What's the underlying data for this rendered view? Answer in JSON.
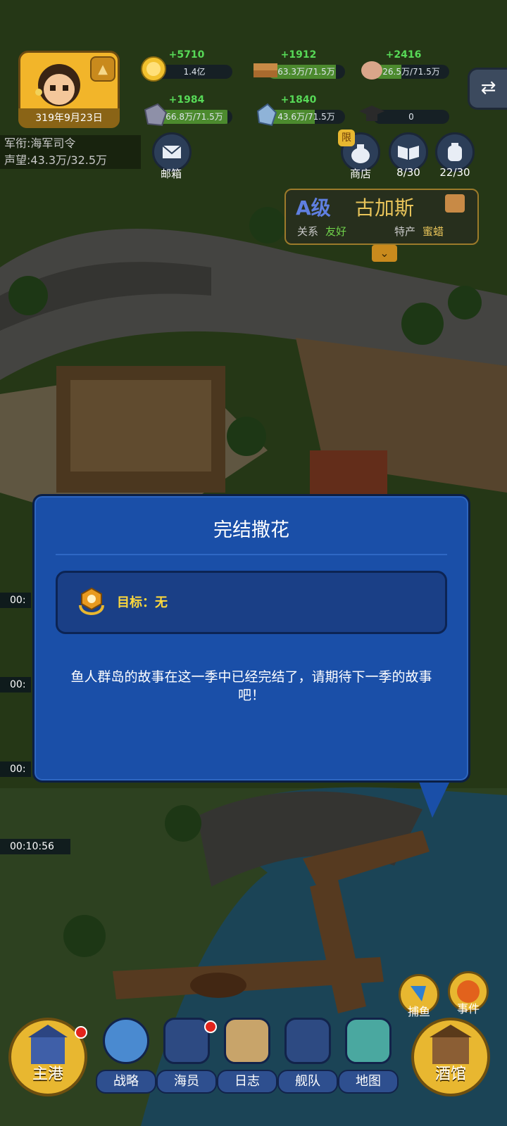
{
  "player": {
    "date": "319年9月23日",
    "rank_label": "军衔:海军司令",
    "fame_label": "声望:43.3万/32.5万"
  },
  "resources": [
    {
      "name": "gold",
      "icon": "gold-coin-icon",
      "gain": "+5710",
      "amount": "1.4亿",
      "fill": 0.0
    },
    {
      "name": "wood",
      "icon": "wood-planks-icon",
      "gain": "+1912",
      "amount": "63.3万/71.5万",
      "fill": 0.885
    },
    {
      "name": "meat",
      "icon": "meat-icon",
      "gain": "+2416",
      "amount": "26.5万/71.5万",
      "fill": 0.37
    },
    {
      "name": "iron",
      "icon": "iron-ore-icon",
      "gain": "+1984",
      "amount": "66.8万/71.5万",
      "fill": 0.934
    },
    {
      "name": "crystal",
      "icon": "crystal-icon",
      "gain": "+1840",
      "amount": "43.6万/71.5万",
      "fill": 0.61
    },
    {
      "name": "scholar",
      "icon": "graduation-cap-icon",
      "gain": "",
      "amount": "0",
      "fill": 0.0
    }
  ],
  "top_buttons": {
    "mail": "邮箱",
    "shop": "商店",
    "shop_tag": "限",
    "books": "8/30",
    "bags": "22/30"
  },
  "city_card": {
    "grade": "A级",
    "name": "古加斯",
    "relation_label": "关系",
    "relation_value": "友好",
    "specialty_label": "特产",
    "specialty_value": "蜜蜡"
  },
  "dialog": {
    "title": "完结撒花",
    "goal": "目标：无",
    "message": "鱼人群岛的故事在这一季中已经完结了，请期待下一季的故事吧！"
  },
  "timers": [
    "00:",
    "00:",
    "00:",
    "00:10:56"
  ],
  "bottom_nav": {
    "home": "主港",
    "strategy": "战略",
    "crew": "海员",
    "log": "日志",
    "fleet": "舰队",
    "map": "地图",
    "tavern": "酒馆",
    "fishing": "捕鱼",
    "events": "事件"
  },
  "colors": {
    "dialog_blue": "#1a4fa8",
    "goal_yellow": "#ffd93b",
    "gain_green": "#57d957"
  }
}
